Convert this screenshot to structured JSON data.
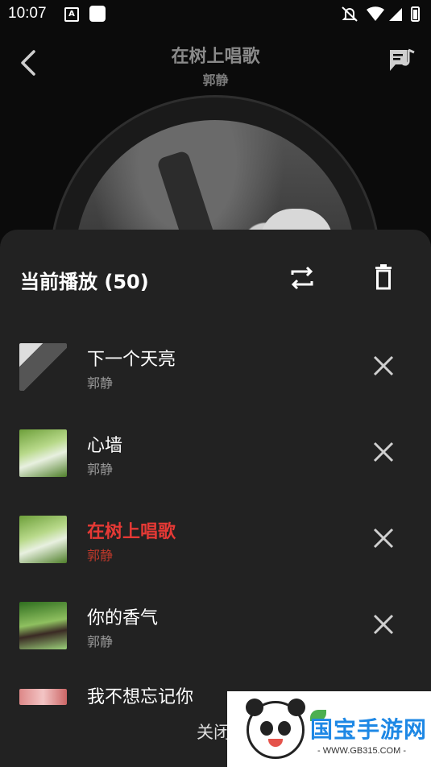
{
  "status_bar": {
    "time": "10:07",
    "notif_glyph": "A",
    "icons": [
      "mute-icon",
      "wifi-icon",
      "signal-icon",
      "battery-icon"
    ]
  },
  "header": {
    "title": "在树上唱歌",
    "artist": "郭静",
    "back_icon": "back-arrow-icon",
    "lyric_icon": "lyrics-icon"
  },
  "playlist": {
    "title": "当前播放 (50)",
    "items": [
      {
        "name": "下一个天亮",
        "artist": "郭静",
        "active": false
      },
      {
        "name": "心墙",
        "artist": "郭静",
        "active": false
      },
      {
        "name": "在树上唱歌",
        "artist": "郭静",
        "active": true
      },
      {
        "name": "你的香气",
        "artist": "郭静",
        "active": false
      },
      {
        "name": "我不想忘记你",
        "artist": "",
        "active": false
      }
    ],
    "close_label": "关闭"
  },
  "watermark": {
    "brand": "国宝手游网",
    "url": "- WWW.GB315.COM -"
  },
  "colors": {
    "accent": "#e53935",
    "sheet_bg": "#222222",
    "watermark_brand": "#1e88e5"
  }
}
